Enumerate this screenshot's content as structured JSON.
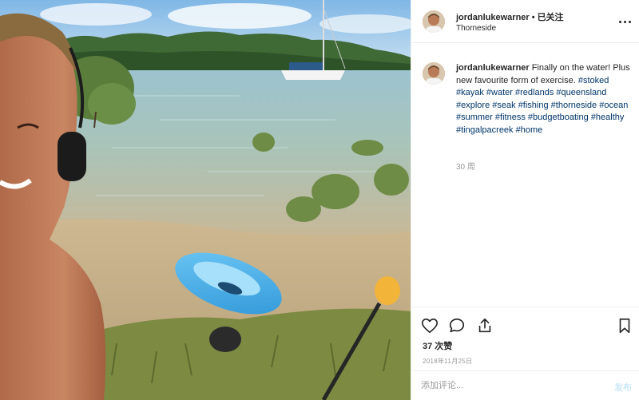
{
  "post": {
    "username": "jordanlukewarner",
    "separator": "•",
    "follow_status": "已关注",
    "location": "Thorneside",
    "caption": {
      "text_line1": "Finally on the water!",
      "text_line2": "Plus new favourite form of exercise.",
      "hashtags": [
        "#stoked",
        "#kayak",
        "#water",
        "#redlands",
        "#queensland",
        "#explore",
        "#seak",
        "#fishing",
        "#thorneside",
        "#ocean",
        "#summer",
        "#fitness",
        "#budgetboating",
        "#healthy",
        "#tingalpacreek",
        "#home"
      ]
    },
    "time_ago": "30 周",
    "likes": "37 次赞",
    "date": "2018年11月25日"
  },
  "comment": {
    "placeholder": "添加评论...",
    "post_label": "发布"
  },
  "colors": {
    "hashtag": "#003569",
    "muted": "#999999",
    "border": "#efefef",
    "post_button": "#b2dffc"
  },
  "icons": {
    "like": "heart-icon",
    "comment": "comment-icon",
    "share": "share-icon",
    "save": "bookmark-icon",
    "more": "more-options-icon"
  }
}
